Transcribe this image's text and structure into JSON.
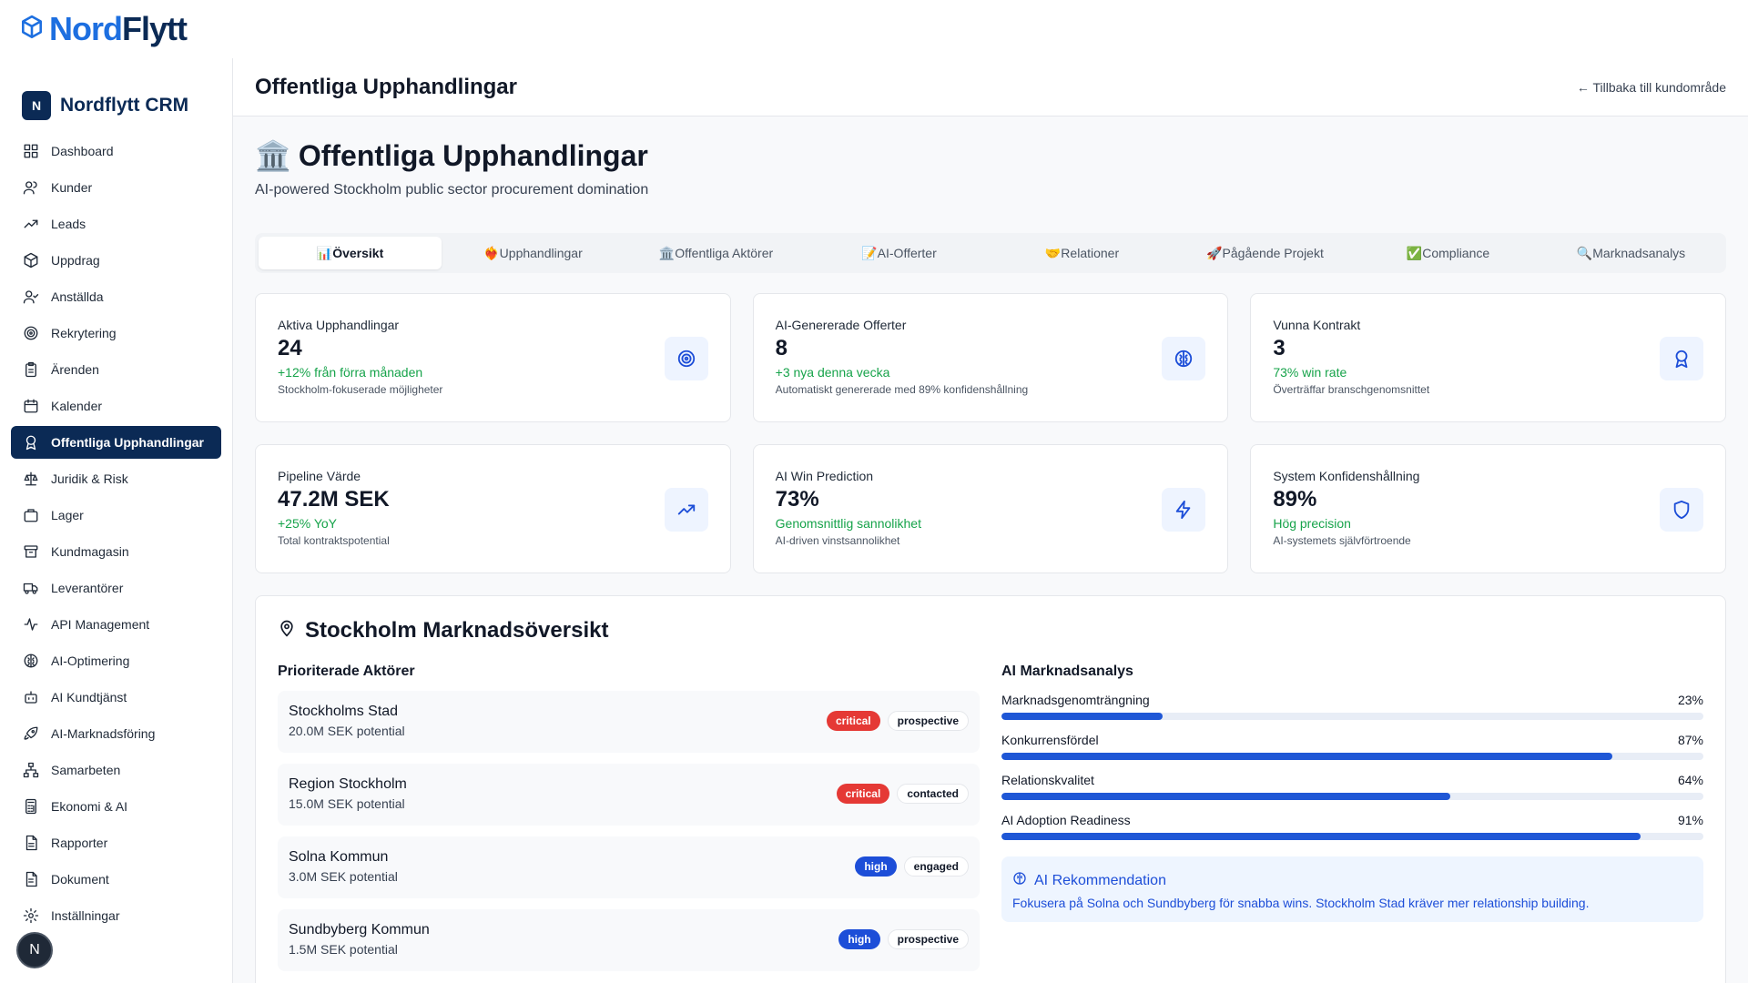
{
  "brand": {
    "part1": "Nord",
    "part2": "Flytt"
  },
  "sidebar": {
    "badge": "N",
    "title": "Nordflytt CRM",
    "items": [
      {
        "label": "Dashboard",
        "icon": "grid-icon"
      },
      {
        "label": "Kunder",
        "icon": "users-icon"
      },
      {
        "label": "Leads",
        "icon": "trending-up-icon"
      },
      {
        "label": "Uppdrag",
        "icon": "package-icon"
      },
      {
        "label": "Anställda",
        "icon": "user-check-icon"
      },
      {
        "label": "Rekrytering",
        "icon": "target-icon"
      },
      {
        "label": "Ärenden",
        "icon": "clipboard-icon"
      },
      {
        "label": "Kalender",
        "icon": "calendar-icon"
      },
      {
        "label": "Offentliga Upphandlingar",
        "icon": "award-icon",
        "active": true
      },
      {
        "label": "Juridik & Risk",
        "icon": "scale-icon"
      },
      {
        "label": "Lager",
        "icon": "box-icon"
      },
      {
        "label": "Kundmagasin",
        "icon": "archive-icon"
      },
      {
        "label": "Leverantörer",
        "icon": "truck-icon"
      },
      {
        "label": "API Management",
        "icon": "activity-icon"
      },
      {
        "label": "AI-Optimering",
        "icon": "brain-icon"
      },
      {
        "label": "AI Kundtjänst",
        "icon": "bot-icon"
      },
      {
        "label": "AI-Marknadsföring",
        "icon": "rocket-icon"
      },
      {
        "label": "Samarbeten",
        "icon": "network-icon"
      },
      {
        "label": "Ekonomi & AI",
        "icon": "calculator-icon"
      },
      {
        "label": "Rapporter",
        "icon": "report-icon"
      },
      {
        "label": "Dokument",
        "icon": "document-icon"
      },
      {
        "label": "Inställningar",
        "icon": "gear-icon"
      }
    ],
    "avatar": "N"
  },
  "header": {
    "title": "Offentliga Upphandlingar",
    "back": "← Tillbaka till kundområde"
  },
  "page": {
    "title": "Offentliga Upphandlingar",
    "title_icon": "🏛️",
    "subtitle": "AI-powered Stockholm public sector procurement domination"
  },
  "tabs": [
    {
      "label": "📊Översikt",
      "active": true
    },
    {
      "label": "❤️‍🔥Upphandlingar"
    },
    {
      "label": "🏛️Offentliga Aktörer"
    },
    {
      "label": "📝AI-Offerter"
    },
    {
      "label": "🤝Relationer"
    },
    {
      "label": "🚀Pågående Projekt"
    },
    {
      "label": "✅Compliance"
    },
    {
      "label": "🔍Marknadsanalys"
    }
  ],
  "stats": [
    {
      "label": "Aktiva Upphandlingar",
      "value": "24",
      "change": "+12% från förra månaden",
      "desc": "Stockholm-fokuserade möjligheter",
      "icon": "target-icon"
    },
    {
      "label": "AI-Genererade Offerter",
      "value": "8",
      "change": "+3 nya denna vecka",
      "desc": "Automatiskt genererade med 89% konfidenshållning",
      "icon": "brain-icon"
    },
    {
      "label": "Vunna Kontrakt",
      "value": "3",
      "change": "73% win rate",
      "desc": "Överträffar branschgenomsnittet",
      "icon": "award-icon"
    },
    {
      "label": "Pipeline Värde",
      "value": "47.2M SEK",
      "change": "+25% YoY",
      "desc": "Total kontraktspotential",
      "icon": "trending-up-icon"
    },
    {
      "label": "AI Win Prediction",
      "value": "73%",
      "change": "Genomsnittlig sannolikhet",
      "desc": "AI-driven vinstsannolikhet",
      "icon": "zap-icon"
    },
    {
      "label": "System Konfidenshållning",
      "value": "89%",
      "change": "Hög precision",
      "desc": "AI-systemets självförtroende",
      "icon": "shield-icon"
    }
  ],
  "market": {
    "title": "Stockholm Marknadsöversikt",
    "actors_heading": "Prioriterade Aktörer",
    "actors": [
      {
        "name": "Stockholms Stad",
        "potential": "20.0M SEK potential",
        "priority": "critical",
        "status": "prospective"
      },
      {
        "name": "Region Stockholm",
        "potential": "15.0M SEK potential",
        "priority": "critical",
        "status": "contacted"
      },
      {
        "name": "Solna Kommun",
        "potential": "3.0M SEK potential",
        "priority": "high",
        "status": "engaged"
      },
      {
        "name": "Sundbyberg Kommun",
        "potential": "1.5M SEK potential",
        "priority": "high",
        "status": "prospective"
      }
    ],
    "analysis_heading": "AI Marknadsanalys",
    "metrics": [
      {
        "label": "Marknadsgenomträngning",
        "value": "23%",
        "fraction": 0.23
      },
      {
        "label": "Konkurrensfördel",
        "value": "87%",
        "fraction": 0.87
      },
      {
        "label": "Relationskvalitet",
        "value": "64%",
        "fraction": 0.64
      },
      {
        "label": "AI Adoption Readiness",
        "value": "91%",
        "fraction": 0.91
      }
    ],
    "recommendation": {
      "title": "AI Rekommendation",
      "text": "Fokusera på Solna och Sundbyberg för snabba wins. Stockholm Stad kräver mer relationship building."
    }
  },
  "colors": {
    "brand_dark": "#0b2a55",
    "brand_blue": "#1d6fe0",
    "accent": "#1f57d6",
    "critical": "#e53935",
    "high": "#1d4ed8",
    "positive": "#16a34a"
  }
}
